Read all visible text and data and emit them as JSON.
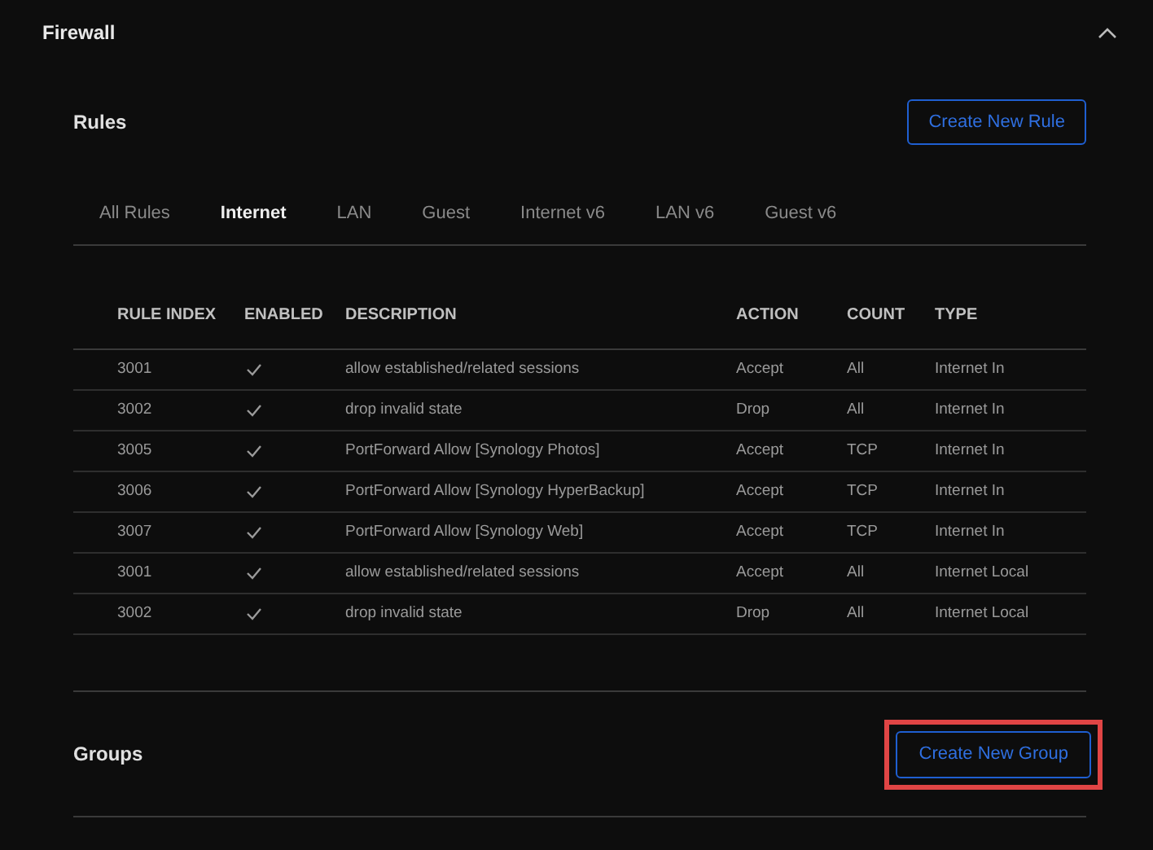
{
  "section": {
    "title": "Firewall",
    "expanded": true
  },
  "rules": {
    "title": "Rules",
    "button": "Create New Rule"
  },
  "tabs": [
    {
      "label": "All Rules",
      "selected": false
    },
    {
      "label": "Internet",
      "selected": true
    },
    {
      "label": "LAN",
      "selected": false
    },
    {
      "label": "Guest",
      "selected": false
    },
    {
      "label": "Internet v6",
      "selected": false
    },
    {
      "label": "LAN v6",
      "selected": false
    },
    {
      "label": "Guest v6",
      "selected": false
    }
  ],
  "table": {
    "columns": [
      "RULE INDEX",
      "ENABLED",
      "DESCRIPTION",
      "ACTION",
      "COUNT",
      "TYPE"
    ],
    "rows": [
      {
        "index": "3001",
        "enabled": true,
        "description": "allow established/related sessions",
        "action": "Accept",
        "count": "All",
        "type": "Internet In"
      },
      {
        "index": "3002",
        "enabled": true,
        "description": "drop invalid state",
        "action": "Drop",
        "count": "All",
        "type": "Internet In"
      },
      {
        "index": "3005",
        "enabled": true,
        "description": "PortForward Allow [Synology Photos]",
        "action": "Accept",
        "count": "TCP",
        "type": "Internet In"
      },
      {
        "index": "3006",
        "enabled": true,
        "description": "PortForward Allow [Synology HyperBackup]",
        "action": "Accept",
        "count": "TCP",
        "type": "Internet In"
      },
      {
        "index": "3007",
        "enabled": true,
        "description": "PortForward Allow [Synology Web]",
        "action": "Accept",
        "count": "TCP",
        "type": "Internet In"
      },
      {
        "index": "3001",
        "enabled": true,
        "description": "allow established/related sessions",
        "action": "Accept",
        "count": "All",
        "type": "Internet Local"
      },
      {
        "index": "3002",
        "enabled": true,
        "description": "drop invalid state",
        "action": "Drop",
        "count": "All",
        "type": "Internet Local"
      }
    ]
  },
  "groups": {
    "title": "Groups",
    "button": "Create New Group",
    "highlighted": true
  }
}
